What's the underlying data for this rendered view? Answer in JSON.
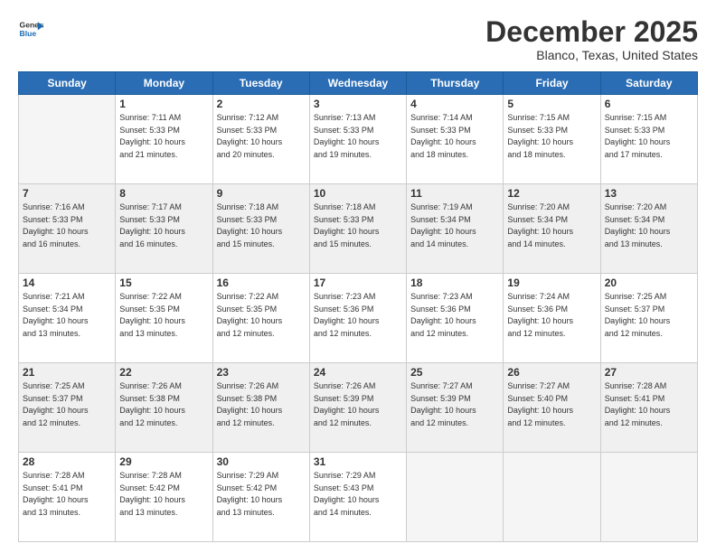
{
  "header": {
    "logo_line1": "General",
    "logo_line2": "Blue",
    "month": "December 2025",
    "location": "Blanco, Texas, United States"
  },
  "weekdays": [
    "Sunday",
    "Monday",
    "Tuesday",
    "Wednesday",
    "Thursday",
    "Friday",
    "Saturday"
  ],
  "rows": [
    [
      {
        "day": "",
        "info": ""
      },
      {
        "day": "1",
        "info": "Sunrise: 7:11 AM\nSunset: 5:33 PM\nDaylight: 10 hours\nand 21 minutes."
      },
      {
        "day": "2",
        "info": "Sunrise: 7:12 AM\nSunset: 5:33 PM\nDaylight: 10 hours\nand 20 minutes."
      },
      {
        "day": "3",
        "info": "Sunrise: 7:13 AM\nSunset: 5:33 PM\nDaylight: 10 hours\nand 19 minutes."
      },
      {
        "day": "4",
        "info": "Sunrise: 7:14 AM\nSunset: 5:33 PM\nDaylight: 10 hours\nand 18 minutes."
      },
      {
        "day": "5",
        "info": "Sunrise: 7:15 AM\nSunset: 5:33 PM\nDaylight: 10 hours\nand 18 minutes."
      },
      {
        "day": "6",
        "info": "Sunrise: 7:15 AM\nSunset: 5:33 PM\nDaylight: 10 hours\nand 17 minutes."
      }
    ],
    [
      {
        "day": "7",
        "info": "Sunrise: 7:16 AM\nSunset: 5:33 PM\nDaylight: 10 hours\nand 16 minutes."
      },
      {
        "day": "8",
        "info": "Sunrise: 7:17 AM\nSunset: 5:33 PM\nDaylight: 10 hours\nand 16 minutes."
      },
      {
        "day": "9",
        "info": "Sunrise: 7:18 AM\nSunset: 5:33 PM\nDaylight: 10 hours\nand 15 minutes."
      },
      {
        "day": "10",
        "info": "Sunrise: 7:18 AM\nSunset: 5:33 PM\nDaylight: 10 hours\nand 15 minutes."
      },
      {
        "day": "11",
        "info": "Sunrise: 7:19 AM\nSunset: 5:34 PM\nDaylight: 10 hours\nand 14 minutes."
      },
      {
        "day": "12",
        "info": "Sunrise: 7:20 AM\nSunset: 5:34 PM\nDaylight: 10 hours\nand 14 minutes."
      },
      {
        "day": "13",
        "info": "Sunrise: 7:20 AM\nSunset: 5:34 PM\nDaylight: 10 hours\nand 13 minutes."
      }
    ],
    [
      {
        "day": "14",
        "info": "Sunrise: 7:21 AM\nSunset: 5:34 PM\nDaylight: 10 hours\nand 13 minutes."
      },
      {
        "day": "15",
        "info": "Sunrise: 7:22 AM\nSunset: 5:35 PM\nDaylight: 10 hours\nand 13 minutes."
      },
      {
        "day": "16",
        "info": "Sunrise: 7:22 AM\nSunset: 5:35 PM\nDaylight: 10 hours\nand 12 minutes."
      },
      {
        "day": "17",
        "info": "Sunrise: 7:23 AM\nSunset: 5:36 PM\nDaylight: 10 hours\nand 12 minutes."
      },
      {
        "day": "18",
        "info": "Sunrise: 7:23 AM\nSunset: 5:36 PM\nDaylight: 10 hours\nand 12 minutes."
      },
      {
        "day": "19",
        "info": "Sunrise: 7:24 AM\nSunset: 5:36 PM\nDaylight: 10 hours\nand 12 minutes."
      },
      {
        "day": "20",
        "info": "Sunrise: 7:25 AM\nSunset: 5:37 PM\nDaylight: 10 hours\nand 12 minutes."
      }
    ],
    [
      {
        "day": "21",
        "info": "Sunrise: 7:25 AM\nSunset: 5:37 PM\nDaylight: 10 hours\nand 12 minutes."
      },
      {
        "day": "22",
        "info": "Sunrise: 7:26 AM\nSunset: 5:38 PM\nDaylight: 10 hours\nand 12 minutes."
      },
      {
        "day": "23",
        "info": "Sunrise: 7:26 AM\nSunset: 5:38 PM\nDaylight: 10 hours\nand 12 minutes."
      },
      {
        "day": "24",
        "info": "Sunrise: 7:26 AM\nSunset: 5:39 PM\nDaylight: 10 hours\nand 12 minutes."
      },
      {
        "day": "25",
        "info": "Sunrise: 7:27 AM\nSunset: 5:39 PM\nDaylight: 10 hours\nand 12 minutes."
      },
      {
        "day": "26",
        "info": "Sunrise: 7:27 AM\nSunset: 5:40 PM\nDaylight: 10 hours\nand 12 minutes."
      },
      {
        "day": "27",
        "info": "Sunrise: 7:28 AM\nSunset: 5:41 PM\nDaylight: 10 hours\nand 12 minutes."
      }
    ],
    [
      {
        "day": "28",
        "info": "Sunrise: 7:28 AM\nSunset: 5:41 PM\nDaylight: 10 hours\nand 13 minutes."
      },
      {
        "day": "29",
        "info": "Sunrise: 7:28 AM\nSunset: 5:42 PM\nDaylight: 10 hours\nand 13 minutes."
      },
      {
        "day": "30",
        "info": "Sunrise: 7:29 AM\nSunset: 5:42 PM\nDaylight: 10 hours\nand 13 minutes."
      },
      {
        "day": "31",
        "info": "Sunrise: 7:29 AM\nSunset: 5:43 PM\nDaylight: 10 hours\nand 14 minutes."
      },
      {
        "day": "",
        "info": ""
      },
      {
        "day": "",
        "info": ""
      },
      {
        "day": "",
        "info": ""
      }
    ]
  ],
  "shaded_rows": [
    1,
    3
  ]
}
